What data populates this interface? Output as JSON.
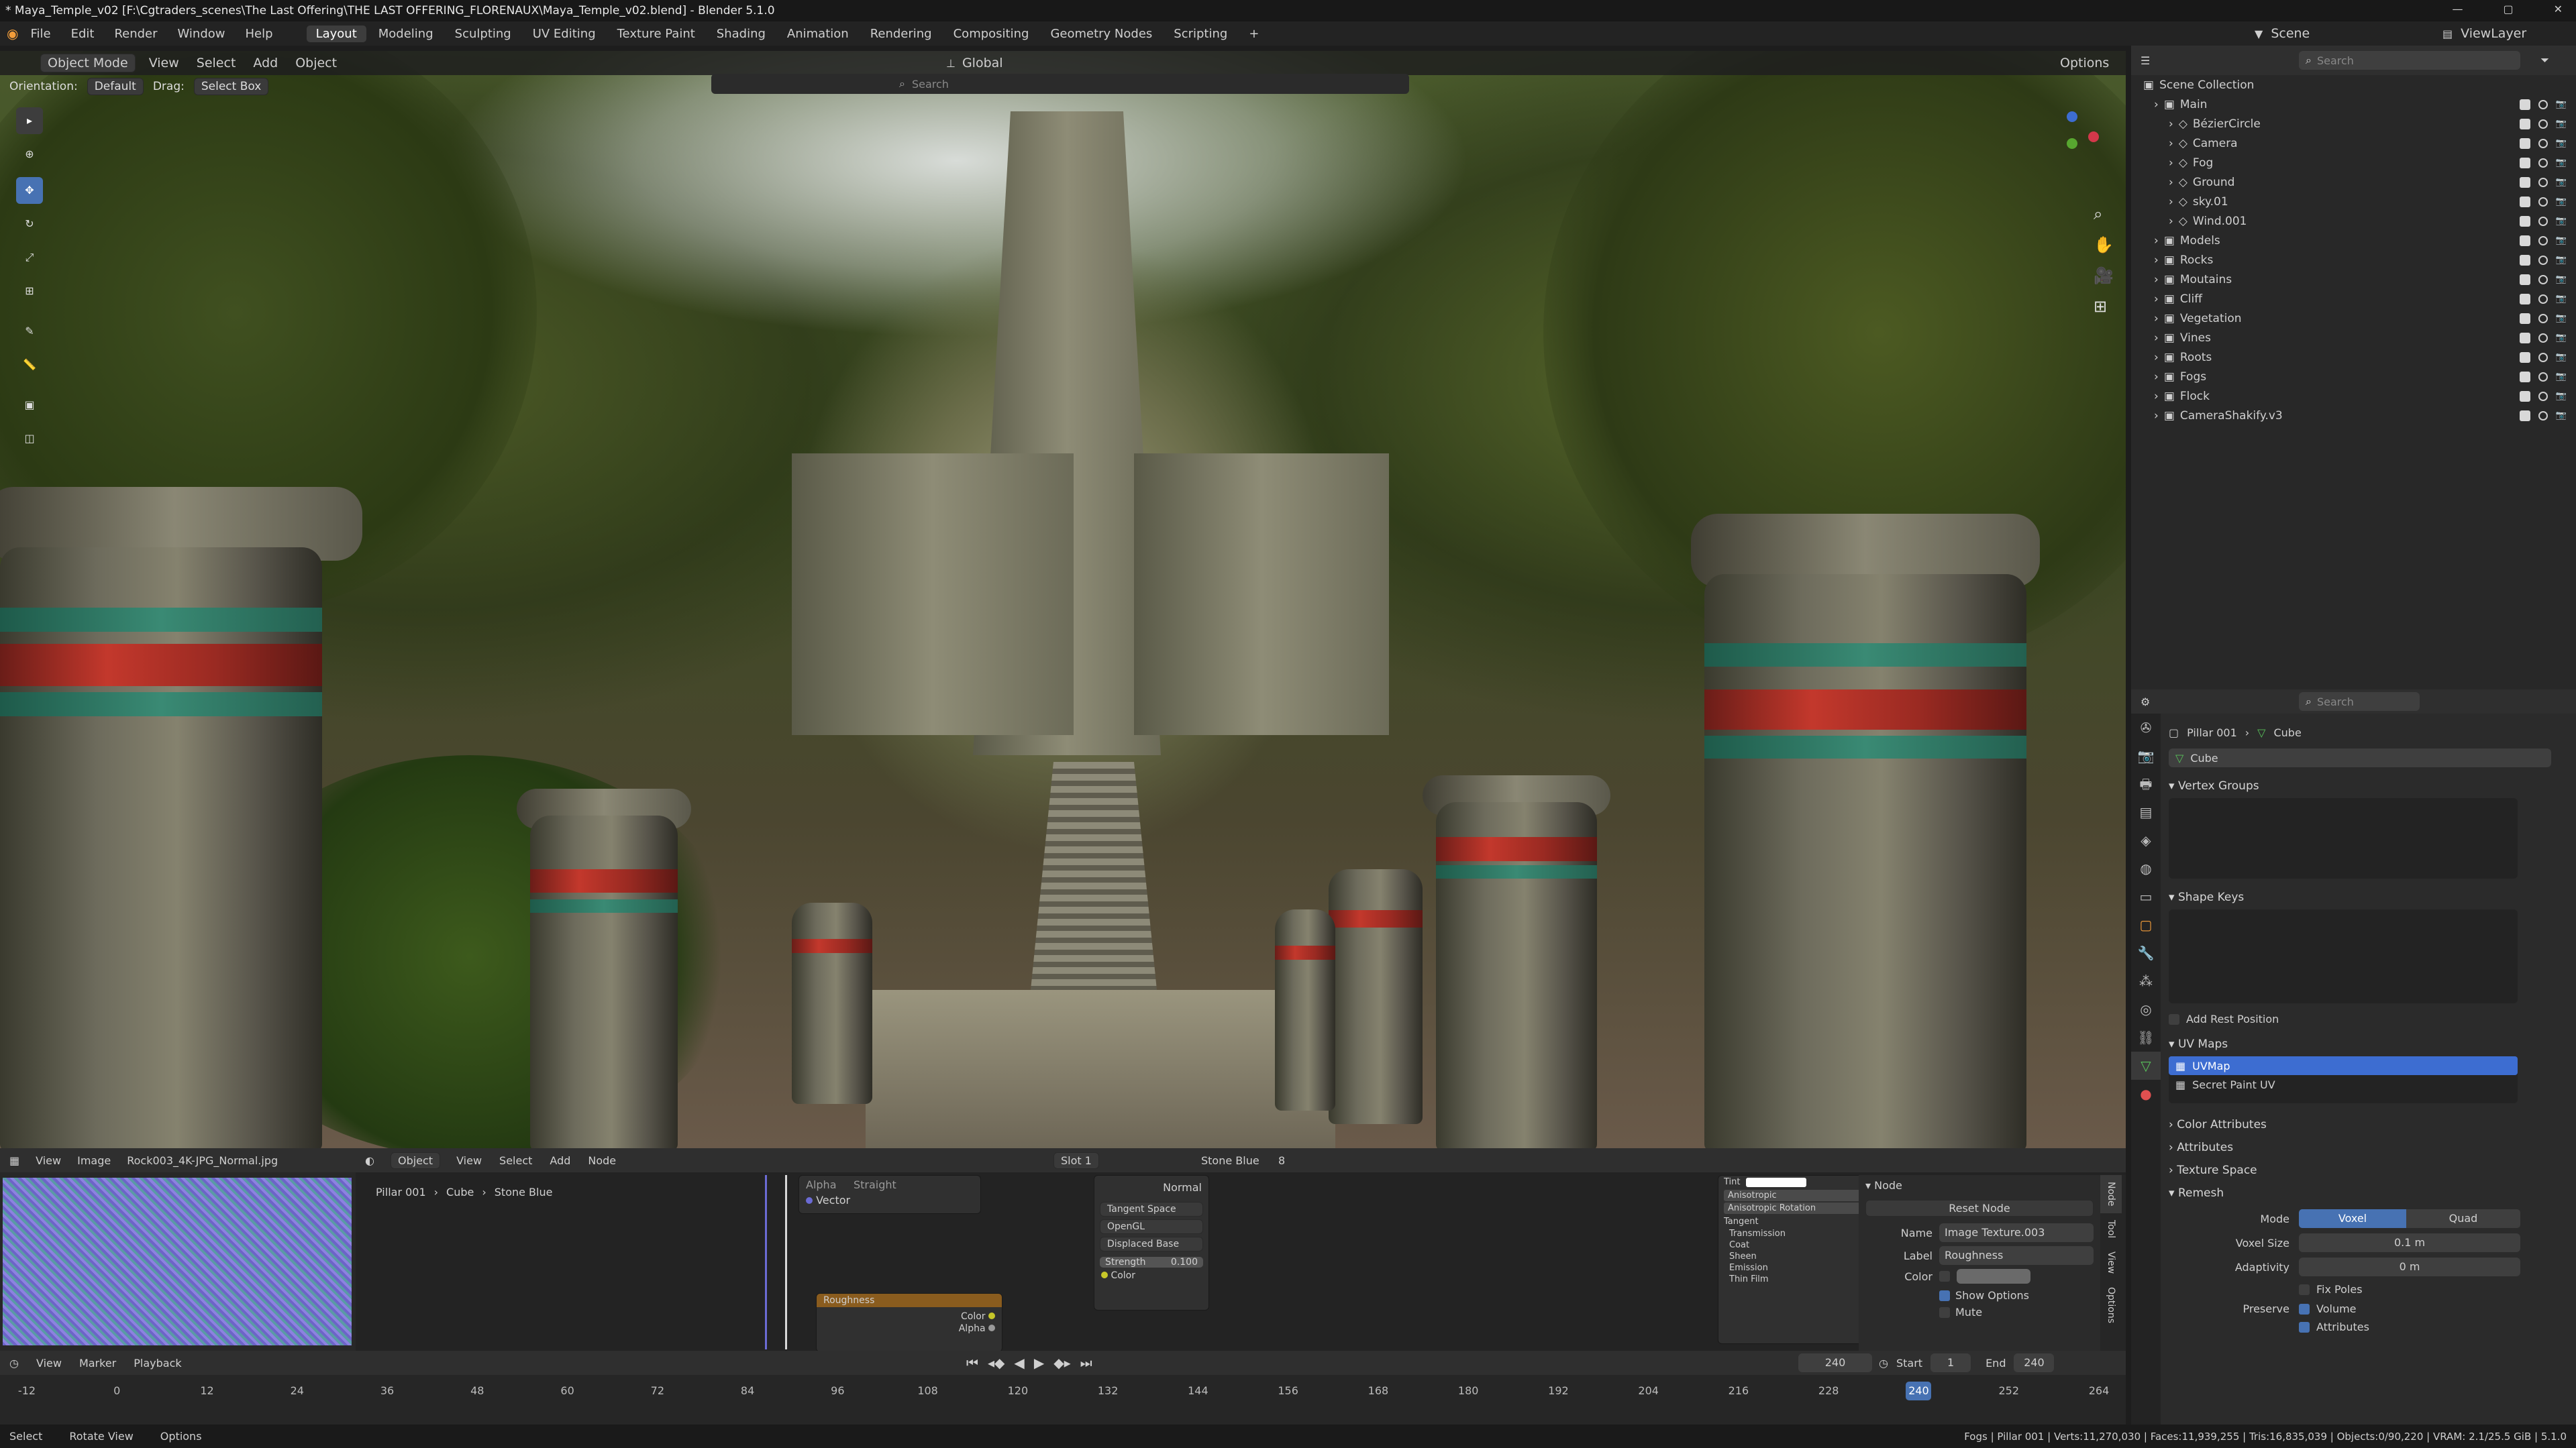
{
  "window": {
    "title": "* Maya_Temple_v02 [F:\\Cgtraders_scenes\\The Last Offering\\THE LAST OFFERING_FLORENAUX\\Maya_Temple_v02.blend] - Blender 5.1.0"
  },
  "menu": [
    "File",
    "Edit",
    "Render",
    "Window",
    "Help"
  ],
  "workspaces": [
    "Layout",
    "Modeling",
    "Sculpting",
    "UV Editing",
    "Texture Paint",
    "Shading",
    "Animation",
    "Rendering",
    "Compositing",
    "Geometry Nodes",
    "Scripting",
    "+"
  ],
  "workspace_active": "Layout",
  "scene": {
    "name": "Scene",
    "view_layer": "ViewLayer"
  },
  "viewport_header": {
    "mode": "Object Mode",
    "items": [
      "View",
      "Select",
      "Add",
      "Object"
    ],
    "transform": "Global",
    "options": "Options"
  },
  "tool_settings": {
    "orientation_label": "Orientation:",
    "orientation": "Default",
    "drag_label": "Drag:",
    "drag": "Select Box"
  },
  "viewport_search": "Search",
  "outliner": {
    "search": "Search",
    "root": "Scene Collection",
    "items": [
      {
        "name": "Main",
        "indent": 0
      },
      {
        "name": "BézierCircle",
        "indent": 1
      },
      {
        "name": "Camera",
        "indent": 1
      },
      {
        "name": "Fog",
        "indent": 1
      },
      {
        "name": "Ground",
        "indent": 1
      },
      {
        "name": "sky.01",
        "indent": 1
      },
      {
        "name": "Wind.001",
        "indent": 1
      },
      {
        "name": "Models",
        "indent": 0
      },
      {
        "name": "Rocks",
        "indent": 0
      },
      {
        "name": "Moutains",
        "indent": 0
      },
      {
        "name": "Cliff",
        "indent": 0
      },
      {
        "name": "Vegetation",
        "indent": 0
      },
      {
        "name": "Vines",
        "indent": 0
      },
      {
        "name": "Roots",
        "indent": 0
      },
      {
        "name": "Fogs",
        "indent": 0
      },
      {
        "name": "Flock",
        "indent": 0
      },
      {
        "name": "CameraShakify.v3",
        "indent": 0
      }
    ]
  },
  "properties": {
    "search": "Search",
    "breadcrumb_object": "Pillar 001",
    "breadcrumb_data": "Cube",
    "mesh_name": "Cube",
    "vertex_groups": "Vertex Groups",
    "shape_keys": "Shape Keys",
    "add_rest_position": "Add Rest Position",
    "uv_maps": "UV Maps",
    "uv_list": [
      "UVMap",
      "Secret Paint UV"
    ],
    "color_attributes": "Color Attributes",
    "attributes": "Attributes",
    "texture_space": "Texture Space",
    "remesh": "Remesh",
    "mode_label": "Mode",
    "mode_voxel": "Voxel",
    "mode_quad": "Quad",
    "voxel_size_label": "Voxel Size",
    "voxel_size": "0.1 m",
    "adaptivity_label": "Adaptivity",
    "adaptivity": "0 m",
    "fix_poles": "Fix Poles",
    "preserve_label": "Preserve",
    "preserve_volume": "Volume",
    "preserve_attributes": "Attributes"
  },
  "image_editor": {
    "menu": [
      "View",
      "Image"
    ],
    "image": "Rock003_4K-JPG_Normal.jpg"
  },
  "node_editor": {
    "mode": "Object",
    "menu": [
      "View",
      "Select",
      "Add",
      "Node"
    ],
    "slot": "Slot 1",
    "material": "Stone Blue",
    "users": "8",
    "breadcrumb": [
      "Pillar 001",
      "Cube",
      "Stone Blue"
    ],
    "node_alpha": "Alpha",
    "node_straight": "Straight",
    "node_vector": "Vector",
    "normal_node": {
      "normal": "Normal",
      "tangent_space": "Tangent Space",
      "opengl": "OpenGL",
      "displaced": "Displaced Base",
      "strength_label": "Strength",
      "strength": "0.100",
      "color": "Color"
    },
    "roughness_node": {
      "title": "Roughness",
      "color": "Color",
      "alpha": "Alpha"
    },
    "bsdf": {
      "tint": "Tint",
      "anisotropic": "Anisotropic",
      "aniso_rot": "Anisotropic Rotation",
      "tangent": "Tangent",
      "transmission": "Transmission",
      "coat": "Coat",
      "sheen": "Sheen",
      "emission": "Emission",
      "thin_film": "Thin Film"
    },
    "sidebar": {
      "header": "Node",
      "reset": "Reset Node",
      "name_label": "Name",
      "name": "Image Texture.003",
      "label_label": "Label",
      "label": "Roughness",
      "color_label": "Color",
      "show_options": "Show Options",
      "mute": "Mute"
    },
    "tabs": [
      "Node",
      "Tool",
      "View",
      "Options"
    ]
  },
  "timeline": {
    "menu": [
      "View",
      "Marker",
      "Playback"
    ],
    "current_frame": "240",
    "start_label": "Start",
    "start": "1",
    "end_label": "End",
    "end": "240",
    "ticks": [
      "-12",
      "0",
      "12",
      "24",
      "36",
      "48",
      "60",
      "72",
      "84",
      "96",
      "108",
      "120",
      "132",
      "144",
      "156",
      "168",
      "180",
      "192",
      "204",
      "216",
      "228",
      "240",
      "252",
      "264"
    ],
    "frame_range": [
      -12,
      264
    ],
    "frame_value": 240
  },
  "statusbar": {
    "left": [
      "Select",
      "Rotate View",
      "Options"
    ],
    "right": "Fogs | Pillar 001 | Verts:11,270,030 | Faces:11,939,255 | Tris:16,835,039 | Objects:0/90,220 | VRAM: 2.1/25.5 GiB | 5.1.0"
  },
  "colors": {
    "accent": "#4772b3",
    "selected": "#3d6dd1",
    "orange": "#f29c3a"
  }
}
